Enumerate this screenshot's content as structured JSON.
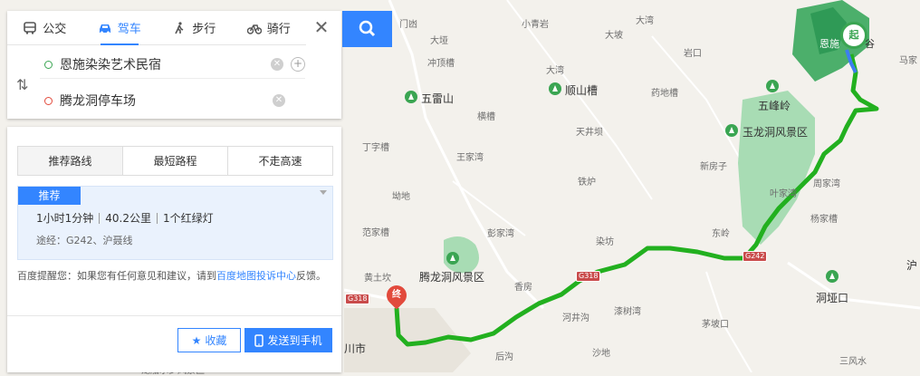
{
  "modes": [
    {
      "label": "公交",
      "icon": "bus-icon"
    },
    {
      "label": "驾车",
      "icon": "car-icon"
    },
    {
      "label": "步行",
      "icon": "walk-icon"
    },
    {
      "label": "骑行",
      "icon": "bike-icon"
    }
  ],
  "active_mode": "驾车",
  "start": "恩施染染艺术民宿",
  "end": "腾龙洞停车场",
  "route_tabs": [
    "推荐路线",
    "最短路程",
    "不走高速"
  ],
  "route": {
    "badge": "推荐",
    "duration": "1小时1分钟",
    "distance": "40.2公里",
    "lights": "1个红绿灯",
    "via": "途经：G242、沪聂线"
  },
  "tip": {
    "prefix": "百度提醒您：如果您有任何意见和建议，请到",
    "link": "百度地图投诉中心",
    "suffix": "反馈。"
  },
  "buttons": {
    "favorite": "收藏",
    "send": "发送到手机"
  },
  "map": {
    "labels": [
      "门凼",
      "小青岩",
      "大湾",
      "大垭",
      "大坡",
      "岩口",
      "马家",
      "冲顶槽",
      "大湾",
      "五雷山",
      "顺山槽",
      "药地槽",
      "横槽",
      "五峰岭",
      "天井坝",
      "玉龙洞风景区",
      "丁字槽",
      "王家湾",
      "新房子",
      "周家湾",
      "铁炉",
      "叶家湾",
      "坳地",
      "杨家槽",
      "范家槽",
      "彭家湾",
      "东岭",
      "染坊",
      "黄土坎",
      "腾龙洞风景区",
      "香房",
      "洞垭口",
      "河井沟",
      "漆树湾",
      "茅坡口",
      "后沟",
      "沙地",
      "三风水",
      "川市",
      "龙船水乡风景区",
      "沪"
    ],
    "shields": [
      "G242",
      "G318",
      "G318"
    ],
    "end_marker": "终",
    "start_marker": "起",
    "start_label": "恩施",
    "start_label2": "谷"
  },
  "colors": {
    "accent": "#3385ff",
    "route": "#22b01f",
    "forest": "#a8dcb4"
  }
}
